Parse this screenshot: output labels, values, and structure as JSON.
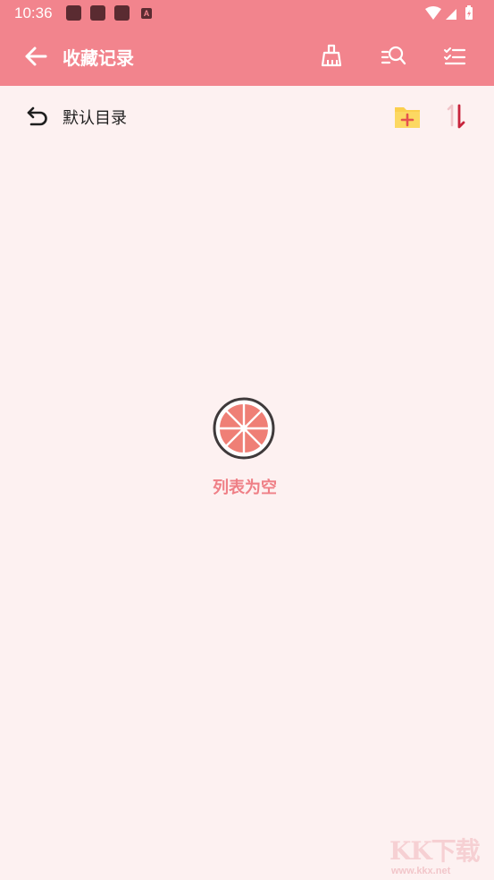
{
  "status_bar": {
    "time": "10:36",
    "badge_letter": "A"
  },
  "app_bar": {
    "title": "收藏记录",
    "actions": [
      "broom-icon",
      "search-list-icon",
      "checklist-icon"
    ]
  },
  "toolbar": {
    "directory_label": "默认目录"
  },
  "empty_state": {
    "message": "列表为空"
  },
  "watermark": {
    "brand": "KK下载",
    "url": "www.kkx.net"
  },
  "colors": {
    "header": "#f2848d",
    "background": "#fdf1f1",
    "accent_text": "#ef7f86",
    "grapefruit": "#ef7f76",
    "folder": "#fbcf4d",
    "sort_down": "#c7243c"
  }
}
